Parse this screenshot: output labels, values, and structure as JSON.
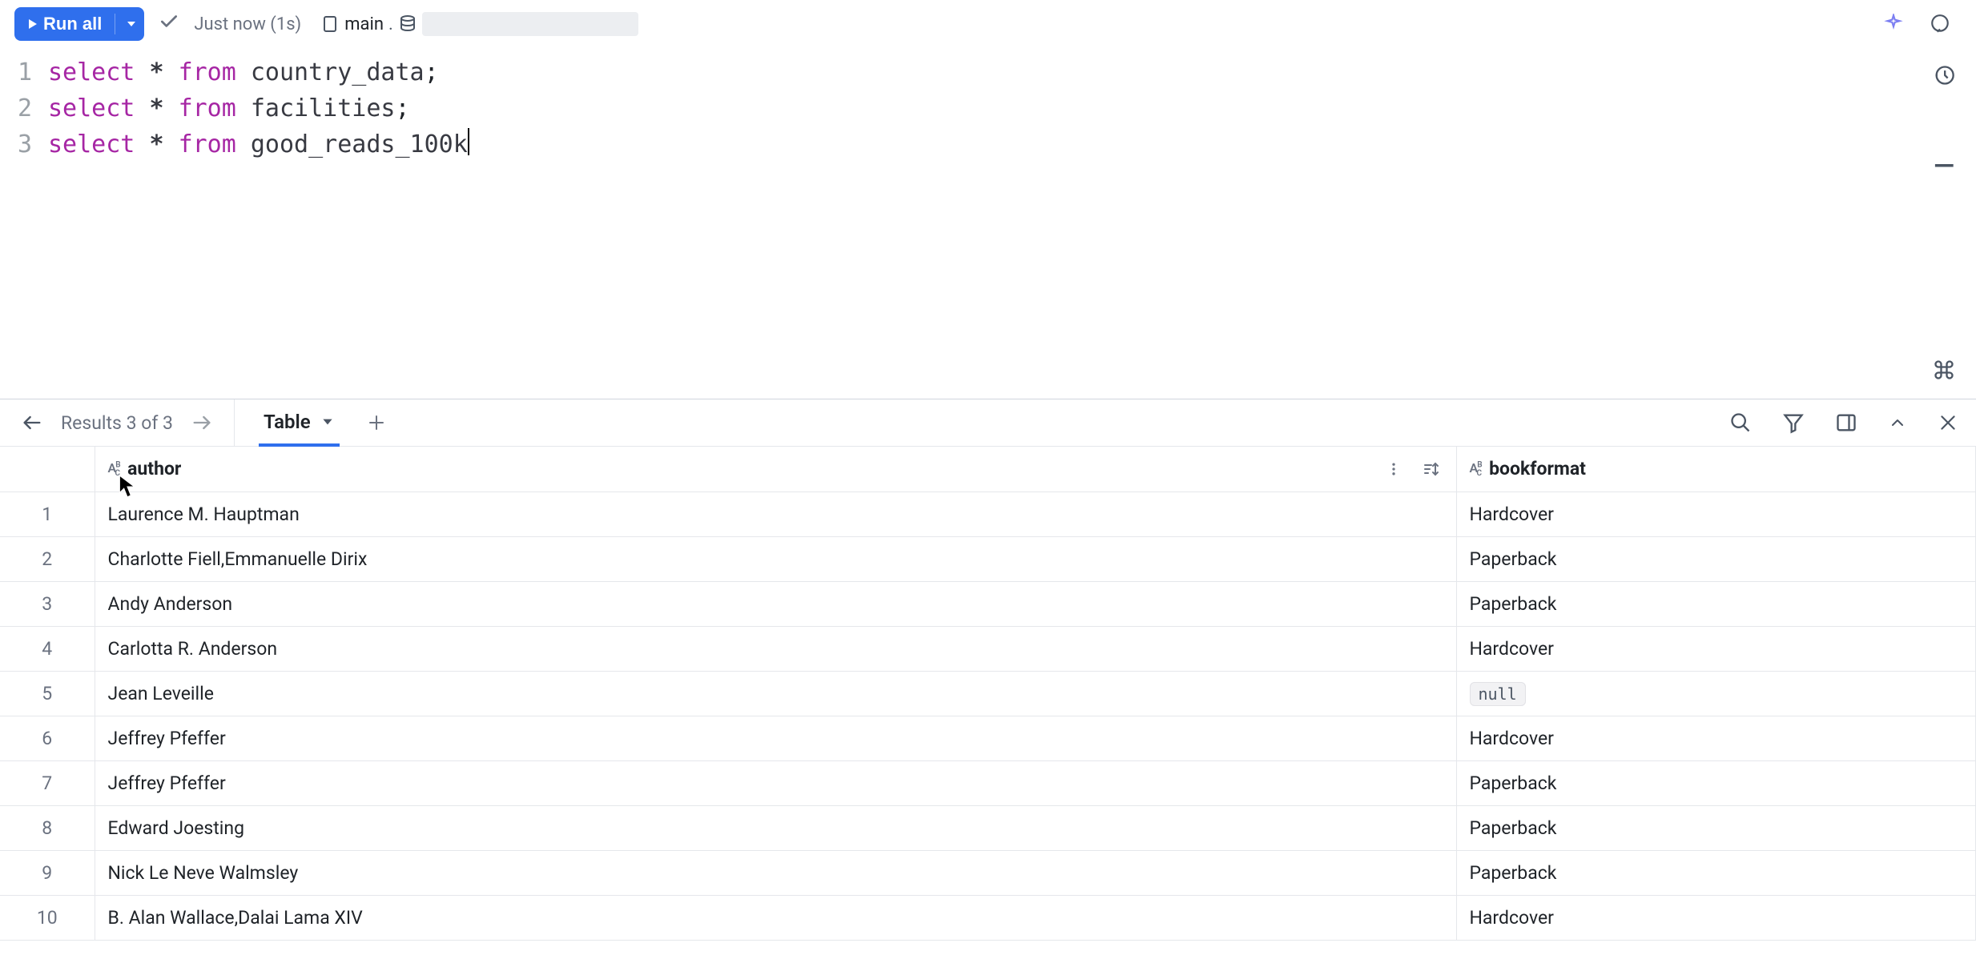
{
  "toolbar": {
    "run_label": "Run all",
    "status_text": "Just now (1s)",
    "schema": "main"
  },
  "editor": {
    "lines": [
      {
        "n": "1",
        "kw1": "select",
        "op": "*",
        "kw2": "from",
        "ident": "country_data",
        "tail": ";"
      },
      {
        "n": "2",
        "kw1": "select",
        "op": "*",
        "kw2": "from",
        "ident": "facilities",
        "tail": ";"
      },
      {
        "n": "3",
        "kw1": "select",
        "op": "*",
        "kw2": "from",
        "ident": "good_reads_100k",
        "tail": ""
      }
    ]
  },
  "results": {
    "nav_label": "Results 3 of 3",
    "tab_label": "Table",
    "columns": {
      "author": "author",
      "bookformat": "bookformat"
    },
    "null_label": "null",
    "rows": [
      {
        "n": "1",
        "author": "Laurence M. Hauptman",
        "bookformat": "Hardcover"
      },
      {
        "n": "2",
        "author": "Charlotte Fiell,Emmanuelle Dirix",
        "bookformat": "Paperback"
      },
      {
        "n": "3",
        "author": "Andy Anderson",
        "bookformat": "Paperback"
      },
      {
        "n": "4",
        "author": "Carlotta R. Anderson",
        "bookformat": "Hardcover"
      },
      {
        "n": "5",
        "author": "Jean Leveille",
        "bookformat": null
      },
      {
        "n": "6",
        "author": "Jeffrey Pfeffer",
        "bookformat": "Hardcover"
      },
      {
        "n": "7",
        "author": "Jeffrey Pfeffer",
        "bookformat": "Paperback"
      },
      {
        "n": "8",
        "author": "Edward Joesting",
        "bookformat": "Paperback"
      },
      {
        "n": "9",
        "author": "Nick Le Neve Walmsley",
        "bookformat": "Paperback"
      },
      {
        "n": "10",
        "author": "B. Alan Wallace,Dalai Lama XIV",
        "bookformat": "Hardcover"
      }
    ]
  }
}
